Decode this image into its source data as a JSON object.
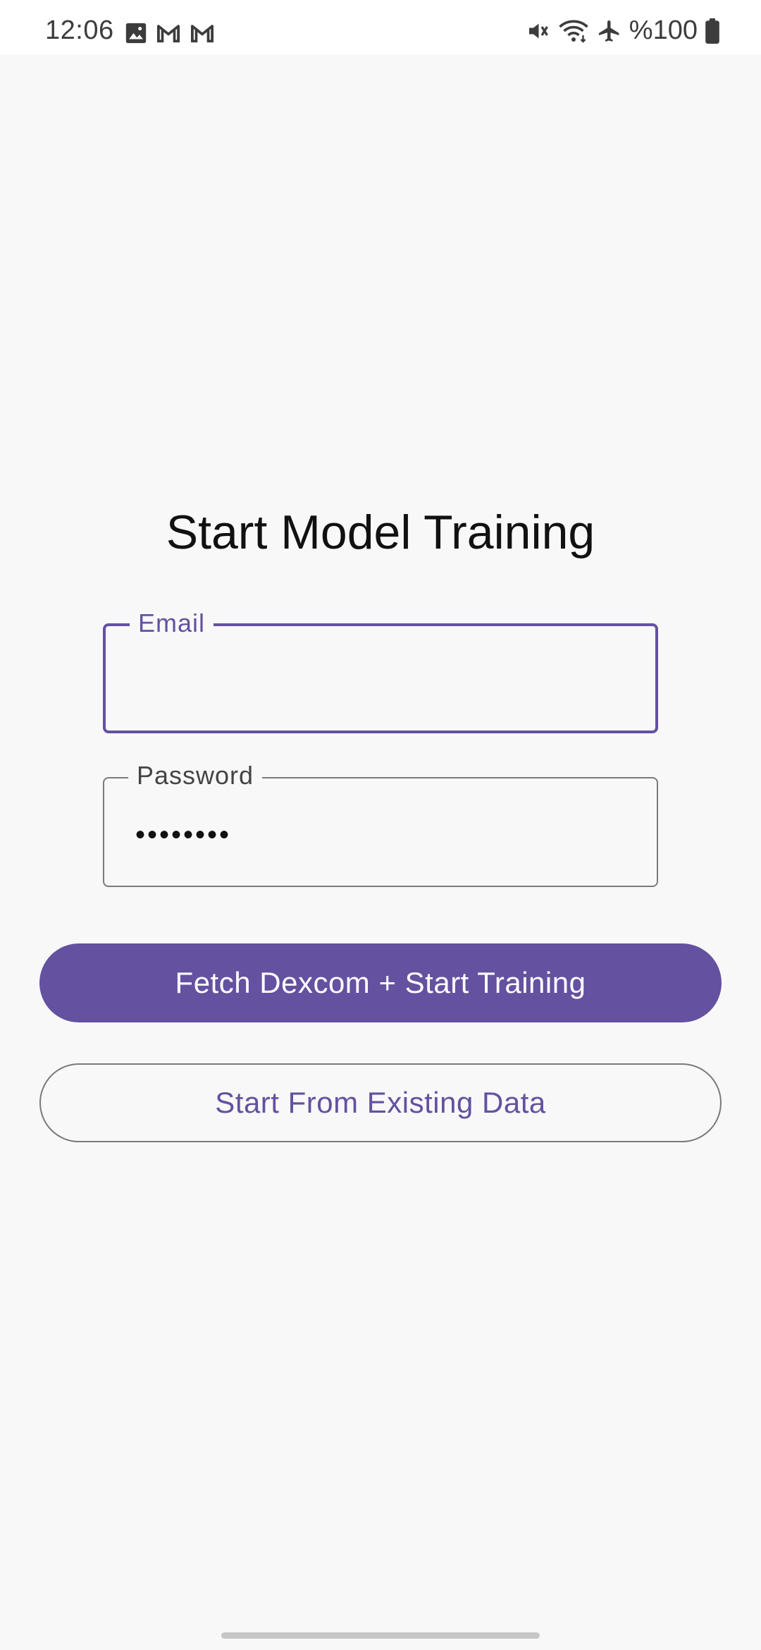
{
  "status_bar": {
    "time": "12:06",
    "left_icons": [
      "image-icon",
      "gmail-icon",
      "gmail-icon"
    ],
    "right_icons": [
      "vibrate-mute-icon",
      "wifi-icon",
      "airplane-icon",
      "battery-icon"
    ],
    "battery_text": "%100"
  },
  "page": {
    "title": "Start Model Training"
  },
  "form": {
    "email": {
      "label": "Email",
      "value": ""
    },
    "password": {
      "label": "Password",
      "masked_value": "••••••••"
    }
  },
  "actions": {
    "primary_label": "Fetch Dexcom + Start Training",
    "secondary_label": "Start From Existing Data"
  },
  "colors": {
    "accent": "#6451a0",
    "background": "#f8f8f8",
    "outline": "#7a7a7a"
  }
}
